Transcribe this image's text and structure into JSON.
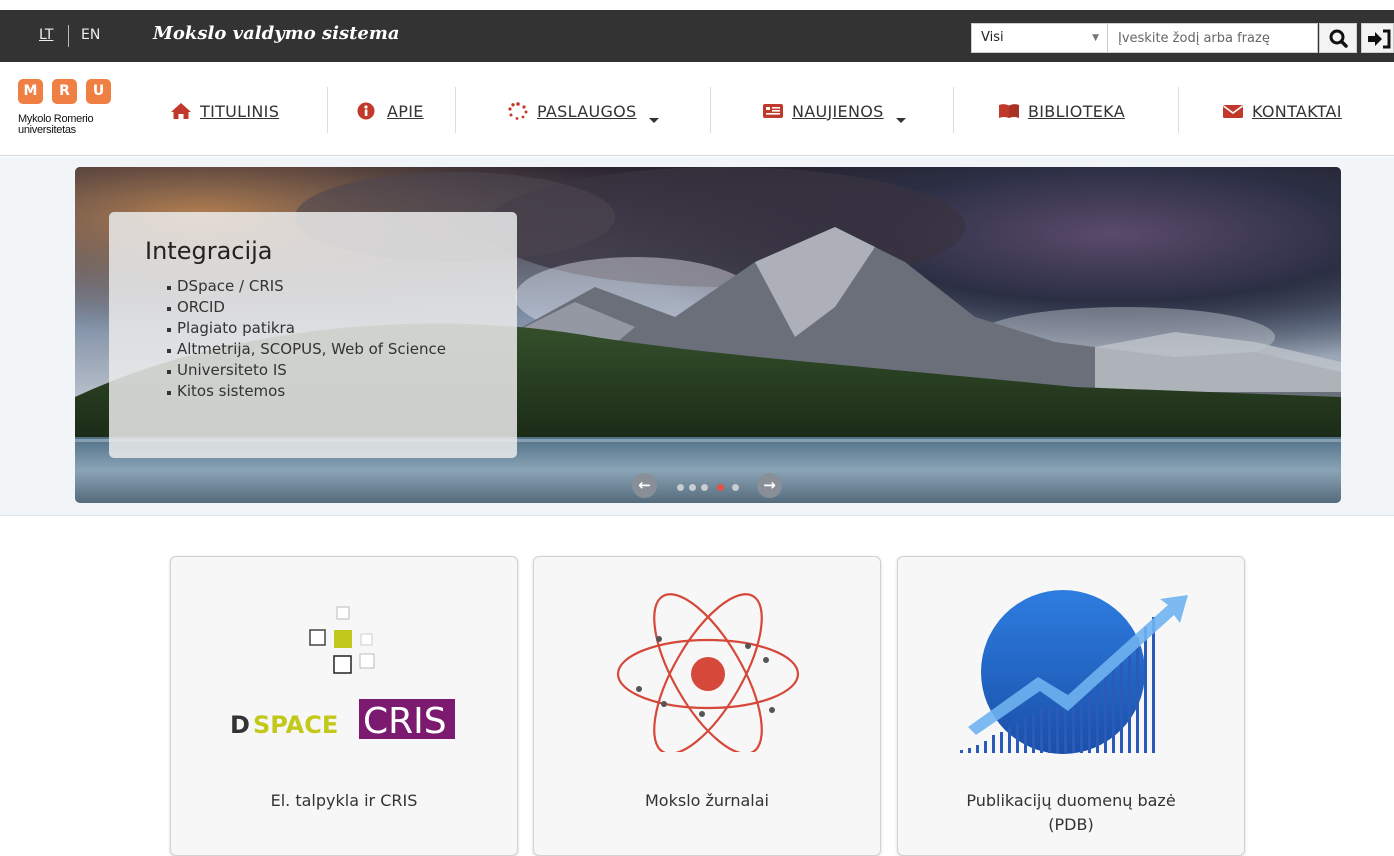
{
  "topbar": {
    "lang_lt": "LT",
    "lang_en": "EN",
    "system_title": "Mokslo valdymo sistema",
    "scope_selected": "Visi",
    "search_placeholder": "Įveskite žodį arba frazę"
  },
  "logo": {
    "letters": [
      "M",
      "R",
      "U"
    ],
    "line1": "Mykolo Romerio",
    "line2": "universitetas"
  },
  "nav": {
    "items": [
      {
        "label": "TITULINIS",
        "icon": "home-icon"
      },
      {
        "label": "APIE",
        "icon": "info-icon"
      },
      {
        "label": "PASLAUGOS",
        "icon": "spinner-icon"
      },
      {
        "label": "NAUJIENOS",
        "icon": "newspaper-icon"
      },
      {
        "label": "BIBLIOTEKA",
        "icon": "book-icon"
      },
      {
        "label": "KONTAKTAI",
        "icon": "envelope-icon"
      }
    ]
  },
  "hero": {
    "title": "Integracija",
    "items": [
      "DSpace / CRIS",
      "ORCID",
      "Plagiato patikra",
      "Altmetrija, SCOPUS, Web of Science",
      "Universiteto IS",
      "Kitos sistemos"
    ],
    "slide_count": 5,
    "active_slide": 4
  },
  "cards": {
    "dspace_logo_d": "D",
    "dspace_logo_space": "SPACE",
    "dspace_logo_cris": "CRIS",
    "repository_label": "El. talpykla ir CRIS",
    "journals_label": "Mokslo žurnalai",
    "pdb_label_line1": "Publikacijų duomenų bazė",
    "pdb_label_line2": "(PDB)"
  },
  "colors": {
    "accent": "#c0392b",
    "logo": "#ef7f43",
    "topbar": "#333333",
    "dspace_yellow": "#c3c91b",
    "cris_purple": "#7b1a6e"
  }
}
